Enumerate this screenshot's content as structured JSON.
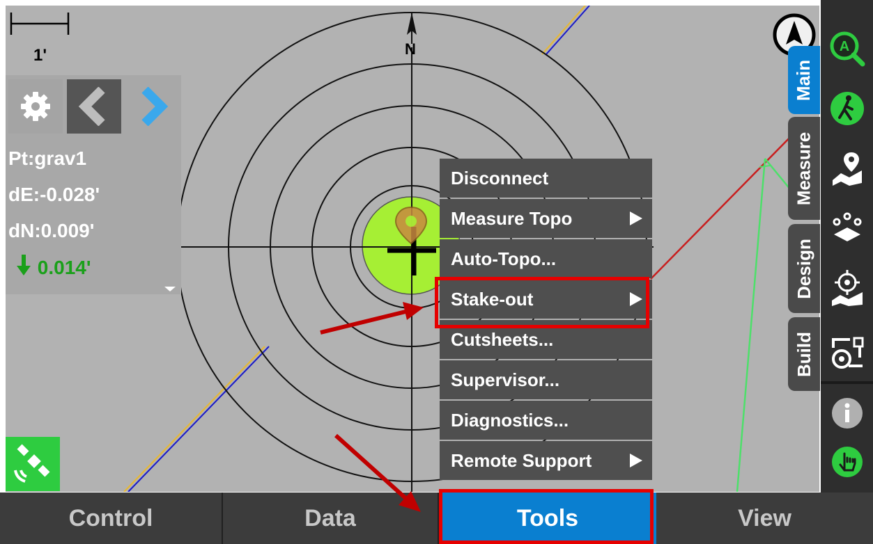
{
  "map": {
    "scale_label": "1'",
    "north_label": "N"
  },
  "left_panel": {
    "point": "Pt:grav1",
    "dE": "dE:-0.028'",
    "dN": "dN:0.009'",
    "cut_fill": "0.014'"
  },
  "menu": {
    "items": [
      {
        "label": "Disconnect",
        "has_submenu": false
      },
      {
        "label": "Measure Topo",
        "has_submenu": true
      },
      {
        "label": "Auto-Topo...",
        "has_submenu": false
      },
      {
        "label": "Stake-out",
        "has_submenu": true
      },
      {
        "label": "Cutsheets...",
        "has_submenu": false
      },
      {
        "label": "Supervisor...",
        "has_submenu": false
      },
      {
        "label": "Diagnostics...",
        "has_submenu": false
      },
      {
        "label": "Remote Support",
        "has_submenu": true
      }
    ]
  },
  "bottom_tabs": [
    "Control",
    "Data",
    "Tools",
    "View"
  ],
  "side_tabs": [
    "Main",
    "Measure",
    "Design",
    "Build"
  ],
  "right_icons": [
    "autoroute-search-icon",
    "walking-person-icon",
    "map-pin-icon",
    "points-layer-icon",
    "stakeout-target-icon",
    "tape-measure-icon",
    "info-icon",
    "touch-hand-icon"
  ],
  "colors": {
    "map_bg": "#b2b2b2",
    "menu_bg": "#4f4f4f",
    "active_blue": "#0a7fd0",
    "highlight_red": "#e60000",
    "target_green": "#a6ef34"
  }
}
